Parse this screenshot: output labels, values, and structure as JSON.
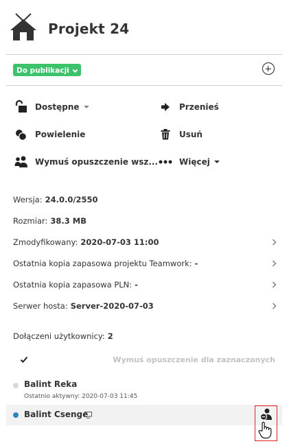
{
  "project": {
    "title": "Projekt 24"
  },
  "status": {
    "label": "Do publikacji",
    "color": "#3cc26a"
  },
  "actions": {
    "available": "Dostępne",
    "move": "Przenieś",
    "duplicate": "Powielenie",
    "delete": "Usuń",
    "force_leave": "Wymuś opuszczenie wsz...",
    "more": "Więcej"
  },
  "info": [
    {
      "label": "Wersja:",
      "value": "24.0.0/2550"
    },
    {
      "label": "Rozmiar:",
      "value": "38.3 MB"
    },
    {
      "label": "Zmodyfikowany:",
      "value": "2020-07-03 11:00"
    },
    {
      "label": "Ostatnia kopia zapasowa projektu Teamwork:",
      "value": "-"
    },
    {
      "label": "Ostatnia kopia zapasowa PLN:",
      "value": "-"
    },
    {
      "label": "Serwer hosta:",
      "value": "Server-2020-07-03"
    }
  ],
  "users": {
    "joined_label": "Dołączeni użytkownicy:",
    "joined_count": "2",
    "kick_selected_label": "Wymuś opuszczenie dla zaznaczonych",
    "list": [
      {
        "name": "Balint Reka",
        "sub": "Ostatnio aktywny: 2020-07-03 11:45",
        "status_color": "#d9d9d9"
      },
      {
        "name": "Balint Csenge",
        "status_color": "#2e86b8"
      }
    ]
  },
  "colors": {
    "highlight_border": "#e0201e",
    "row_highlight": "#f2f2f2"
  },
  "icons": [
    "house-icon",
    "chevron-down-icon",
    "plus-circle-icon",
    "unlock-icon",
    "arrow-right-icon",
    "duplicate-icon",
    "trash-icon",
    "users-icon",
    "more-dots-icon",
    "chevron-right-icon",
    "checkmark-icon",
    "monitor-icon",
    "user-remove-icon",
    "hand-cursor-icon"
  ]
}
